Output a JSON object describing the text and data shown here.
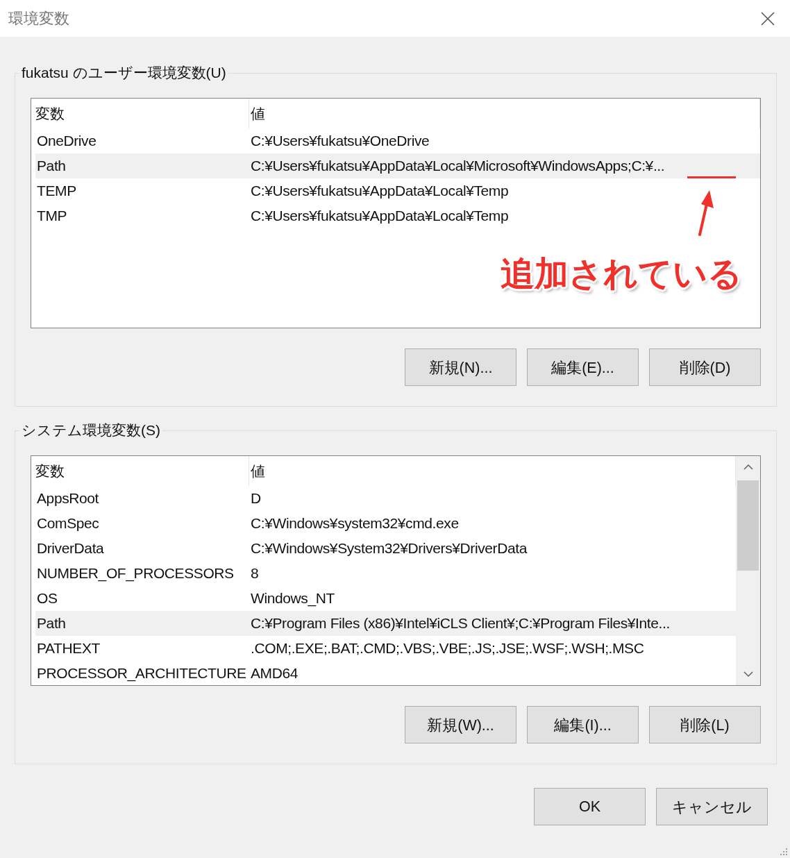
{
  "window": {
    "title": "環境変数"
  },
  "groups": [
    {
      "label": "fukatsu のユーザー環境変数(U)",
      "columns": [
        "変数",
        "値"
      ],
      "scrollbar": false,
      "rows": [
        {
          "name": "OneDrive",
          "value": "C:¥Users¥fukatsu¥OneDrive",
          "selected": false
        },
        {
          "name": "Path",
          "value": "C:¥Users¥fukatsu¥AppData¥Local¥Microsoft¥WindowsApps;C:¥...",
          "selected": true
        },
        {
          "name": "TEMP",
          "value": "C:¥Users¥fukatsu¥AppData¥Local¥Temp",
          "selected": false
        },
        {
          "name": "TMP",
          "value": "C:¥Users¥fukatsu¥AppData¥Local¥Temp",
          "selected": false
        }
      ],
      "annotation": {
        "text": "追加されている"
      },
      "buttons": [
        "新規(N)...",
        "編集(E)...",
        "削除(D)"
      ]
    },
    {
      "label": "システム環境変数(S)",
      "columns": [
        "変数",
        "値"
      ],
      "scrollbar": true,
      "rows": [
        {
          "name": "AppsRoot",
          "value": "D",
          "selected": false
        },
        {
          "name": "ComSpec",
          "value": "C:¥Windows¥system32¥cmd.exe",
          "selected": false
        },
        {
          "name": "DriverData",
          "value": "C:¥Windows¥System32¥Drivers¥DriverData",
          "selected": false
        },
        {
          "name": "NUMBER_OF_PROCESSORS",
          "value": "8",
          "selected": false
        },
        {
          "name": "OS",
          "value": "Windows_NT",
          "selected": false
        },
        {
          "name": "Path",
          "value": "C:¥Program Files (x86)¥Intel¥iCLS Client¥;C:¥Program Files¥Inte...",
          "selected": true
        },
        {
          "name": "PATHEXT",
          "value": ".COM;.EXE;.BAT;.CMD;.VBS;.VBE;.JS;.JSE;.WSF;.WSH;.MSC",
          "selected": false
        },
        {
          "name": "PROCESSOR_ARCHITECTURE",
          "value": "AMD64",
          "selected": false
        }
      ],
      "buttons": [
        "新規(W)...",
        "編集(I)...",
        "削除(L)"
      ]
    }
  ],
  "buttons": [
    "OK",
    "キャンセル"
  ]
}
